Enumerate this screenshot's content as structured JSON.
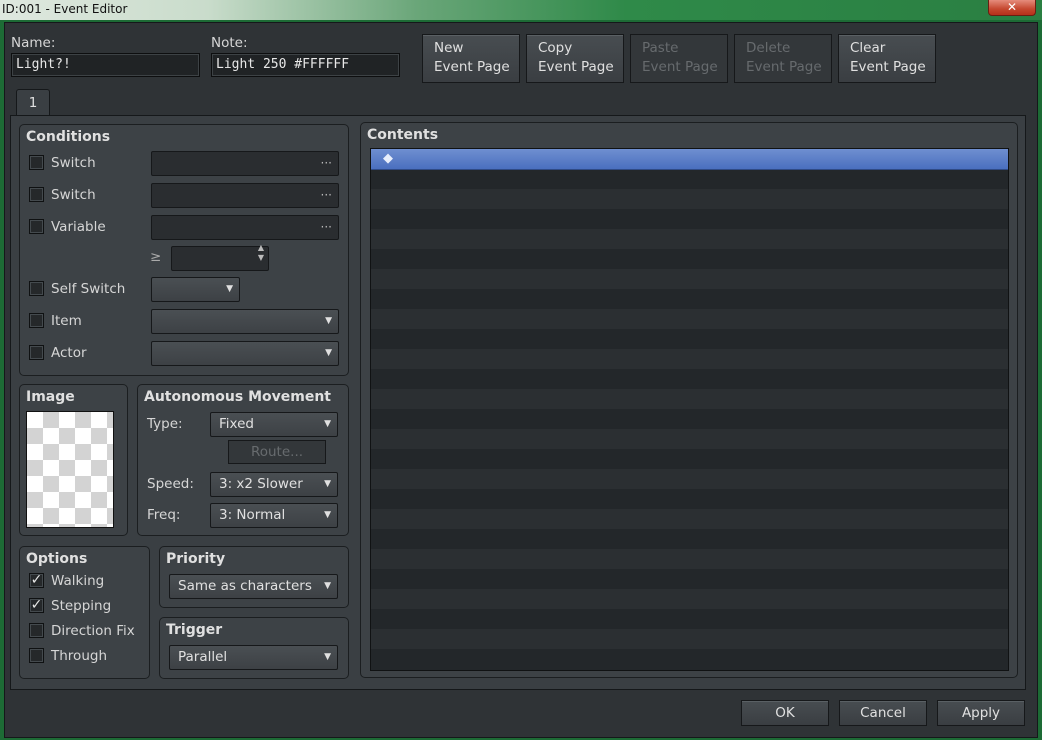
{
  "window": {
    "title": "ID:001 - Event Editor",
    "close_glyph": "✕"
  },
  "header": {
    "name_label": "Name:",
    "name_value": "Light?!",
    "note_label": "Note:",
    "note_value": "Light 250 #FFFFFF",
    "buttons": [
      {
        "line1": "New",
        "line2": "Event Page",
        "enabled": true
      },
      {
        "line1": "Copy",
        "line2": "Event Page",
        "enabled": true
      },
      {
        "line1": "Paste",
        "line2": "Event Page",
        "enabled": false
      },
      {
        "line1": "Delete",
        "line2": "Event Page",
        "enabled": false
      },
      {
        "line1": "Clear",
        "line2": "Event Page",
        "enabled": true
      }
    ]
  },
  "tabs": [
    "1"
  ],
  "conditions": {
    "title": "Conditions",
    "switch1_label": "Switch",
    "switch2_label": "Switch",
    "variable_label": "Variable",
    "compare_symbol": "≥",
    "self_switch_label": "Self Switch",
    "item_label": "Item",
    "actor_label": "Actor",
    "ellipsis": "···"
  },
  "image": {
    "title": "Image"
  },
  "movement": {
    "title": "Autonomous Movement",
    "type_label": "Type:",
    "type_value": "Fixed",
    "route_label": "Route...",
    "speed_label": "Speed:",
    "speed_value": "3: x2 Slower",
    "freq_label": "Freq:",
    "freq_value": "3: Normal"
  },
  "options": {
    "title": "Options",
    "items": [
      {
        "label": "Walking",
        "checked": true
      },
      {
        "label": "Stepping",
        "checked": true
      },
      {
        "label": "Direction Fix",
        "checked": false
      },
      {
        "label": "Through",
        "checked": false
      }
    ]
  },
  "priority": {
    "title": "Priority",
    "value": "Same as characters"
  },
  "trigger": {
    "title": "Trigger",
    "value": "Parallel"
  },
  "contents": {
    "title": "Contents",
    "first_row_marker": "◆"
  },
  "footer": {
    "ok": "OK",
    "cancel": "Cancel",
    "apply": "Apply"
  },
  "colors": {
    "selection": "#4a6fbf",
    "background": "#2f3336"
  }
}
